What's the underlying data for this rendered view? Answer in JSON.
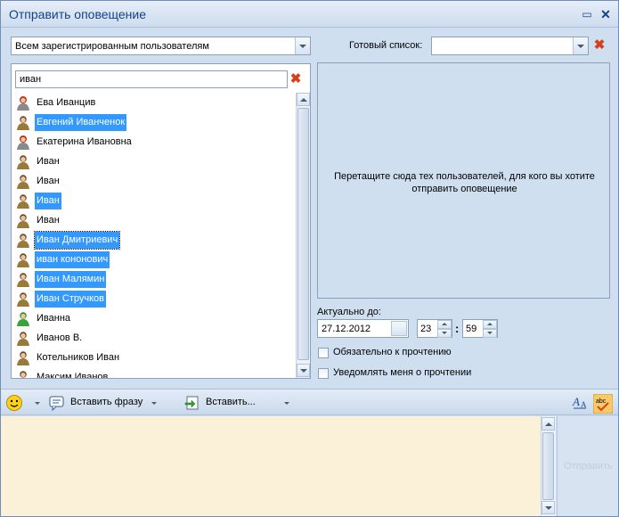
{
  "window": {
    "title": "Отправить оповещение"
  },
  "recipients": {
    "selected": "Всем зарегистрированным пользователям"
  },
  "ready_list": {
    "label": "Готовый список:",
    "value": ""
  },
  "search": {
    "value": "иван"
  },
  "users": [
    {
      "name": "Ева Иванцив",
      "icon": "user-female-icon",
      "selected": false
    },
    {
      "name": "Евгений Иванченок",
      "icon": "user-male-icon",
      "selected": true
    },
    {
      "name": "Екатерина Ивановна",
      "icon": "user-female-icon",
      "selected": false
    },
    {
      "name": "Иван",
      "icon": "user-male-icon",
      "selected": false
    },
    {
      "name": "Иван",
      "icon": "user-male-icon",
      "selected": false
    },
    {
      "name": "Иван",
      "icon": "user-male-icon",
      "selected": true
    },
    {
      "name": "Иван",
      "icon": "user-male-icon",
      "selected": false
    },
    {
      "name": "Иван Дмитриевич",
      "icon": "user-male-icon",
      "selected": true,
      "focused": true
    },
    {
      "name": "иван кононович",
      "icon": "user-male-icon",
      "selected": true
    },
    {
      "name": "Иван Малямин",
      "icon": "user-male-icon",
      "selected": true
    },
    {
      "name": "Иван Стручков",
      "icon": "user-male-icon",
      "selected": true
    },
    {
      "name": "Иванна",
      "icon": "user-online-icon",
      "selected": false
    },
    {
      "name": "Иванов В.",
      "icon": "user-male-icon",
      "selected": false
    },
    {
      "name": "Котельников Иван",
      "icon": "user-male-icon",
      "selected": false
    },
    {
      "name": "Максим Иванов",
      "icon": "user-male-icon",
      "selected": false
    }
  ],
  "drop_area": {
    "message": "Перетащите сюда тех пользователей, для кого вы хотите отправить оповещение"
  },
  "valid_until": {
    "label": "Актуально до:",
    "date": "27.12.2012",
    "hour": "23",
    "separator": ":",
    "minute": "59"
  },
  "options": {
    "required_read": "Обязательно к прочтению",
    "notify_read": "Уведомлять меня о прочтении"
  },
  "toolbar": {
    "insert_phrase": "Вставить фразу",
    "insert": "Вставить..."
  },
  "send": {
    "label": "Отправить"
  },
  "colors": {
    "selection": "#3399ff",
    "editor_bg": "#fbf1d8",
    "panel_bg": "#cfdff0",
    "title_text": "#15428b"
  }
}
